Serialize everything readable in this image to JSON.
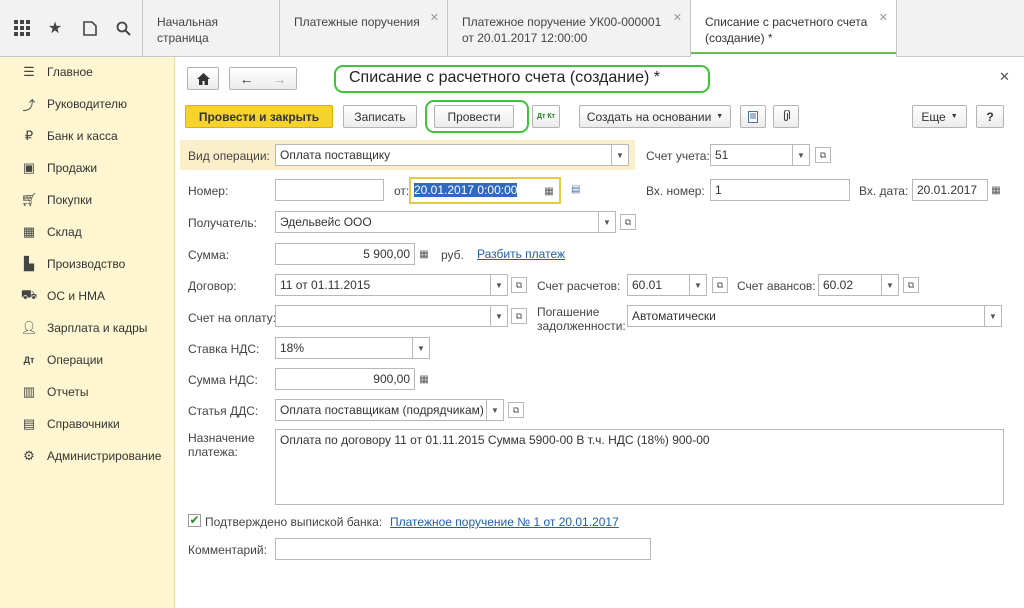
{
  "tabs": [
    {
      "label": "Начальная страница"
    },
    {
      "label": "Платежные поручения"
    },
    {
      "line1": "Платежное поручение УК00-000001",
      "line2": "от 20.01.2017 12:00:00"
    },
    {
      "line1": "Списание с расчетного счета",
      "line2": "(создание) *"
    }
  ],
  "sidebar": {
    "items": [
      {
        "label": "Главное"
      },
      {
        "label": "Руководителю"
      },
      {
        "label": "Банк и касса"
      },
      {
        "label": "Продажи"
      },
      {
        "label": "Покупки"
      },
      {
        "label": "Склад"
      },
      {
        "label": "Производство"
      },
      {
        "label": "ОС и НМА"
      },
      {
        "label": "Зарплата и кадры"
      },
      {
        "label": "Операции"
      },
      {
        "label": "Отчеты"
      },
      {
        "label": "Справочники"
      },
      {
        "label": "Администрирование"
      }
    ]
  },
  "form": {
    "title": "Списание с расчетного счета (создание) *",
    "toolbar": {
      "post_close": "Провести и закрыть",
      "save": "Записать",
      "post": "Провести",
      "dtkt": "Дт Кт",
      "create_based": "Создать на основании",
      "more": "Еще",
      "help": "?"
    },
    "vid_operacii": {
      "label": "Вид операции:",
      "value": "Оплата поставщику"
    },
    "schet_ucheta": {
      "label": "Счет учета:",
      "value": "51"
    },
    "nomer": {
      "label": "Номер:",
      "value": ""
    },
    "ot": {
      "label": "от:",
      "value": "20.01.2017  0:00:00"
    },
    "vh_nomer": {
      "label": "Вх. номер:",
      "value": "1"
    },
    "vh_data": {
      "label": "Вх. дата:",
      "value": "20.01.2017"
    },
    "poluchatel": {
      "label": "Получатель:",
      "value": "Эдельвейс ООО"
    },
    "summa": {
      "label": "Сумма:",
      "value": "5 900,00",
      "unit": "руб.",
      "split_link": "Разбить платеж"
    },
    "dogovor": {
      "label": "Договор:",
      "value": "11 от 01.11.2015"
    },
    "schet_raschetov": {
      "label": "Счет расчетов:",
      "value": "60.01"
    },
    "schet_avansov": {
      "label": "Счет авансов:",
      "value": "60.02"
    },
    "schet_na_oplatu": {
      "label": "Счет на оплату:",
      "value": ""
    },
    "pogashenie": {
      "label1": "Погашение",
      "label2": "задолженности:",
      "value": "Автоматически"
    },
    "stavka_nds": {
      "label": "Ставка НДС:",
      "value": "18%"
    },
    "summa_nds": {
      "label": "Сумма НДС:",
      "value": "900,00"
    },
    "statya_dds": {
      "label": "Статья ДДС:",
      "value": "Оплата поставщикам (подрядчикам)"
    },
    "naznachenie": {
      "label1": "Назначение",
      "label2": "платежа:",
      "value": "Оплата по договору 11 от 01.11.2015 Сумма 5900-00 В т.ч. НДС  (18%) 900-00"
    },
    "confirmed": {
      "label": "Подтверждено выпиской банка:",
      "link": "Платежное поручение № 1 от 20.01.2017",
      "checked": true
    },
    "kommentariy": {
      "label": "Комментарий:",
      "value": ""
    }
  },
  "colors": {
    "accent_yellow": "#f6d22c",
    "sidebar_bg": "#fdf6d0",
    "highlight_green": "#3dc439",
    "link_blue": "#2160a8"
  }
}
